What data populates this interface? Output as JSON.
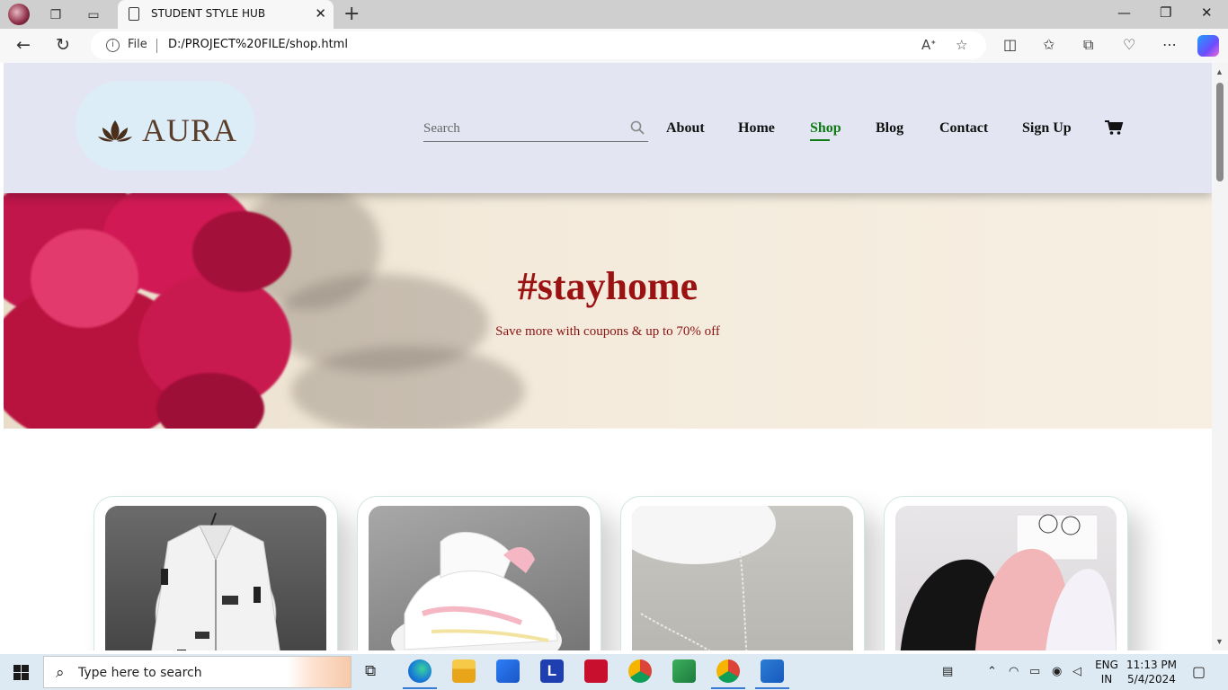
{
  "browser": {
    "tab_title": "STUDENT STYLE HUB",
    "address_scheme": "File",
    "url": "D:/PROJECT%20FILE/shop.html"
  },
  "site": {
    "logo_text": "AURA",
    "search_placeholder": "Search",
    "nav": [
      "About",
      "Home",
      "Shop",
      "Blog",
      "Contact",
      "Sign Up"
    ],
    "active_nav": "Shop"
  },
  "hero": {
    "title": "#stayhome",
    "subtitle": "Save more with coupons & up to 70% off"
  },
  "products": [
    {
      "image": "white-hooded-jacket"
    },
    {
      "image": "pink-white-sneakers"
    },
    {
      "image": "silver-chain-necklace"
    },
    {
      "image": "baseball-caps"
    }
  ],
  "taskbar": {
    "search_placeholder": "Type here to search",
    "lang_1": "ENG",
    "lang_2": "IN",
    "time": "11:13 PM",
    "date": "5/4/2024"
  },
  "colors": {
    "header_bg": "#e3e6f2",
    "active_link": "#0f7a14",
    "hero_text": "#9b1212"
  }
}
